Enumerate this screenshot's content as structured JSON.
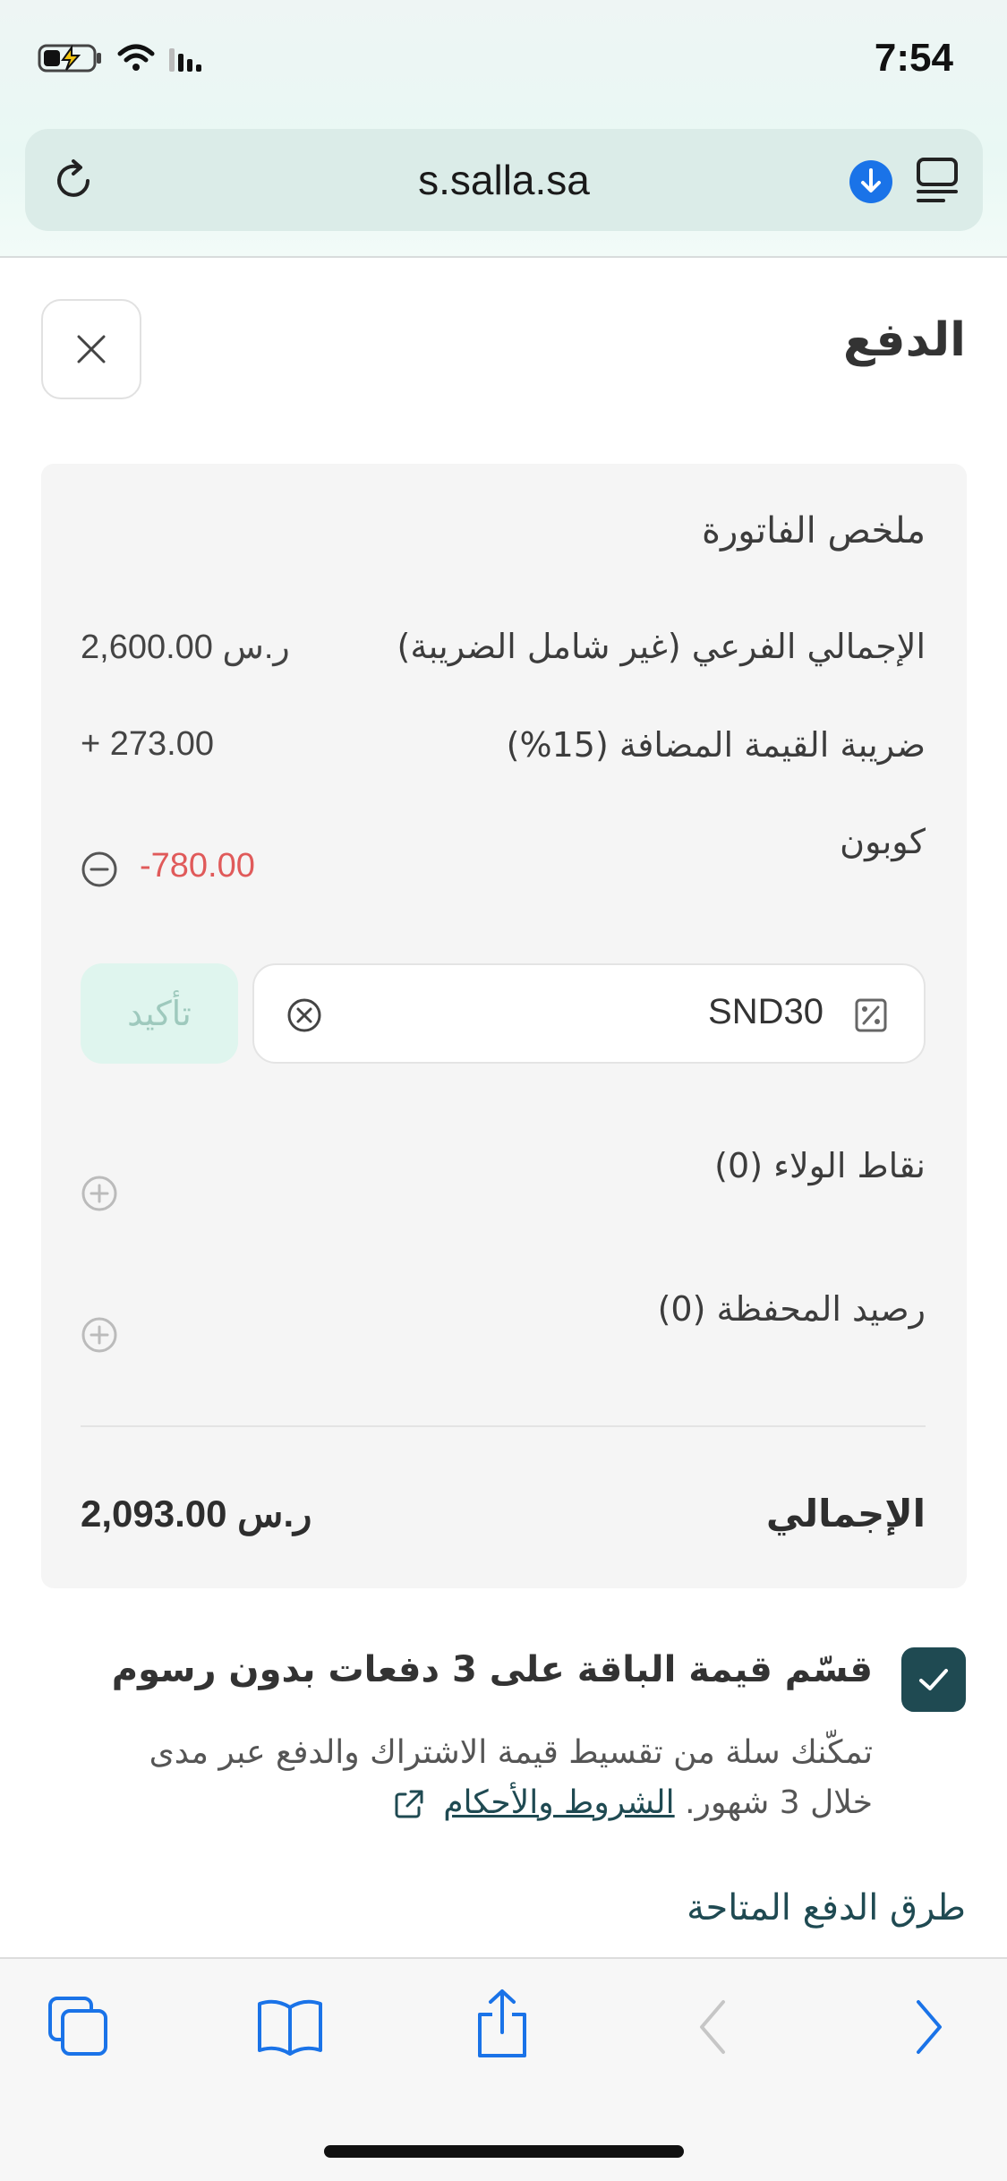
{
  "status_bar": {
    "time": "7:54"
  },
  "browser": {
    "url": "s.salla.sa"
  },
  "page": {
    "title": "الدفع"
  },
  "invoice": {
    "heading": "ملخص الفاتورة",
    "subtotal_label": "الإجمالي الفرعي (غير شامل الضريبة)",
    "subtotal_value": "2,600.00 ر.س",
    "vat_label": "ضريبة القيمة المضافة (15%)",
    "vat_value": "+ 273.00",
    "coupon_label": "كوبون",
    "coupon_value": "-780.00",
    "coupon_code": "SND30",
    "confirm_label": "تأكيد",
    "loyalty_label": "نقاط الولاء (0)",
    "wallet_label": "رصيد المحفظة (0)",
    "total_label": "الإجمالي",
    "total_value": "2,093.00 ر.س"
  },
  "installments": {
    "checked": true,
    "title": "قسّم قيمة الباقة على 3 دفعات بدون رسوم",
    "desc": "تمكّنك سلة من تقسيط قيمة الاشتراك والدفع عبر مدى خلال 3 شهور.",
    "terms_link": "الشروط والأحكام"
  },
  "payment_methods_heading": "طرق الدفع المتاحة",
  "colors": {
    "accent": "#1f4a52",
    "negative": "#e05a5a",
    "confirm_bg": "#dff5ee",
    "ios_blue": "#1a73e8"
  }
}
